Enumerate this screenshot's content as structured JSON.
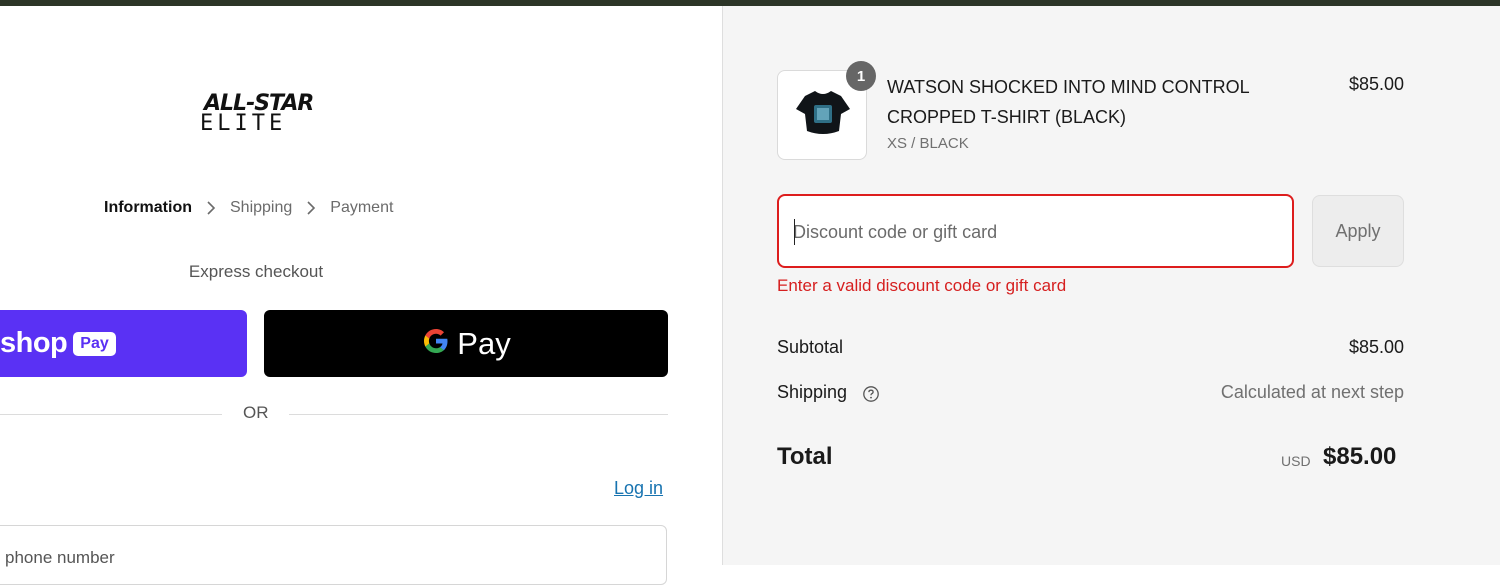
{
  "colors": {
    "shop_pay": "#5a31f4",
    "gpay": "#000000",
    "error": "#d61f1f",
    "link": "#1773b0",
    "summary_bg": "#f5f5f5"
  },
  "brand": {
    "logo_line1": "ALL-STAR",
    "logo_line2": "ELITE"
  },
  "breadcrumb": {
    "steps": [
      "Information",
      "Shipping",
      "Payment"
    ],
    "active": "Information",
    "separator_icon": "chevron-right-icon"
  },
  "express": {
    "label": "Express checkout",
    "shop_pay": {
      "word": "shop",
      "pill": "Pay"
    },
    "google_pay": {
      "text": "Pay",
      "icon": "google-g-icon"
    },
    "or_label": "OR"
  },
  "contact": {
    "login_label": "Log in",
    "phone_placeholder": "phone number"
  },
  "order_summary": {
    "item": {
      "title": "WATSON SHOCKED INTO MIND CONTROL CROPPED T-SHIRT (BLACK)",
      "variant": "XS / BLACK",
      "price": "$85.00",
      "quantity": "1",
      "image_icon": "tshirt-thumbnail"
    },
    "discount": {
      "placeholder": "Discount code or gift card",
      "value": "",
      "apply_label": "Apply",
      "error": "Enter a valid discount code or gift card"
    },
    "subtotal": {
      "label": "Subtotal",
      "value": "$85.00"
    },
    "shipping": {
      "label": "Shipping",
      "value": "Calculated at next step",
      "help_icon": "question-circle-icon"
    },
    "total": {
      "label": "Total",
      "currency": "USD",
      "value": "$85.00"
    }
  }
}
